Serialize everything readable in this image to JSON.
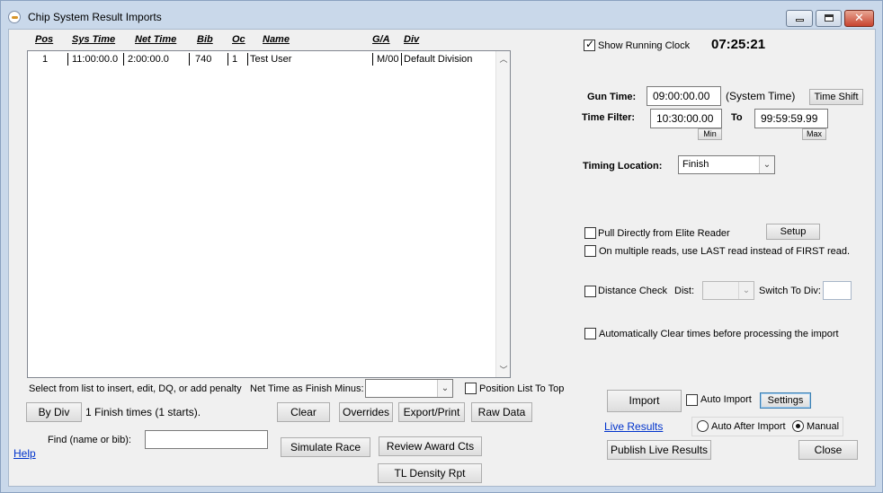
{
  "window": {
    "title": "Chip System Result Imports"
  },
  "results_table": {
    "columns": [
      "Pos",
      "Sys Time",
      "Net Time",
      "Bib",
      "Oc",
      "Name",
      "G/A",
      "Div"
    ],
    "rows": [
      {
        "pos": "1",
        "sys_time": "11:00:00.0",
        "net_time": "2:00:00.0",
        "bib": "740",
        "oc": "1",
        "name": "Test User",
        "ga": "M/00",
        "div": "Default Division"
      }
    ]
  },
  "left_controls": {
    "hint": "Select from list to insert, edit, DQ, or add penalty",
    "net_time_label": "Net Time as Finish Minus:",
    "net_time_value": "",
    "position_top_label": "Position List To Top",
    "position_top_checked": false,
    "by_div_label": "By Div",
    "finish_count": "1 Finish times (1 starts).",
    "clear_label": "Clear",
    "overrides_label": "Overrides",
    "export_label": "Export/Print",
    "raw_data_label": "Raw Data",
    "find_label": "Find (name or bib):",
    "find_value": "",
    "simulate_label": "Simulate Race",
    "review_award_label": "Review Award Cts",
    "tl_density_label": "TL Density Rpt",
    "help_label": "Help"
  },
  "right_panel": {
    "show_clock_label": "Show Running Clock",
    "show_clock_checked": true,
    "clock_value": "07:25:21",
    "gun_time_label": "Gun Time:",
    "gun_time_value": "09:00:00.00",
    "system_time_label": "(System Time)",
    "time_shift_label": "Time Shift",
    "time_filter_label": "Time Filter:",
    "filter_from": "10:30:00.00",
    "to_label": "To",
    "filter_to": "99:59:59.99",
    "min_label": "Min",
    "max_label": "Max",
    "timing_location_label": "Timing Location:",
    "timing_location_value": "Finish",
    "pull_elite_label": "Pull Directly from Elite Reader",
    "setup_label": "Setup",
    "last_read_label": "On multiple reads, use LAST read instead of FIRST read.",
    "distance_check_label": "Distance Check",
    "dist_label": "Dist:",
    "switch_div_label": "Switch To Div:",
    "auto_clear_label": "Automatically Clear times before processing the import",
    "import_label": "Import",
    "auto_import_label": "Auto Import",
    "settings_label": "Settings",
    "live_results_label": "Live Results",
    "auto_after_import_label": "Auto After Import",
    "manual_label": "Manual",
    "publish_label": "Publish Live Results",
    "close_label": "Close"
  }
}
